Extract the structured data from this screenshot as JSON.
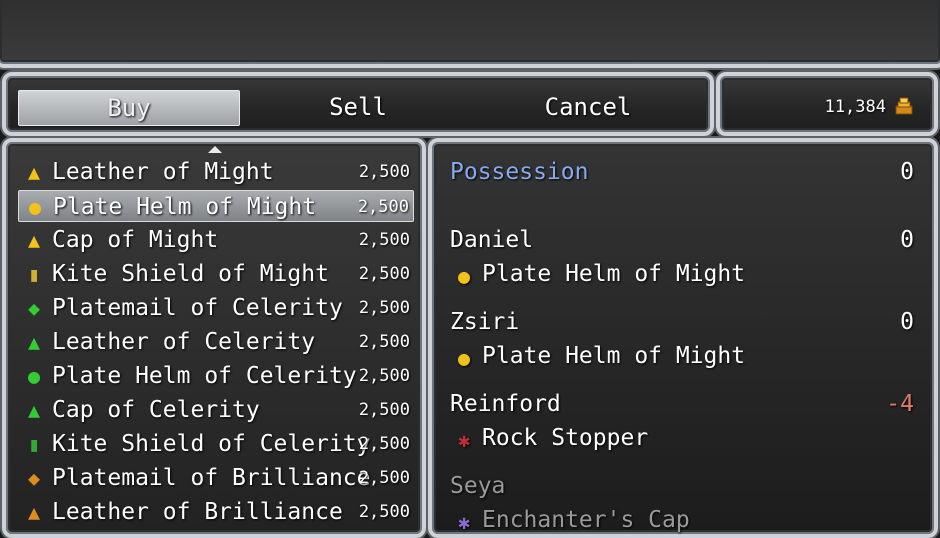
{
  "command_window": {
    "buy_label": "Buy",
    "sell_label": "Sell",
    "cancel_label": "Cancel",
    "selected": "Buy"
  },
  "gold": {
    "value": "11,384",
    "icon": "gold-coin-icon"
  },
  "item_list": [
    {
      "name": "Leather of Might",
      "price": "2,500",
      "icon": "armor-icon",
      "color": "#f2c21a"
    },
    {
      "name": "Plate Helm of Might",
      "price": "2,500",
      "icon": "helm-icon",
      "color": "#f2c21a",
      "selected": true
    },
    {
      "name": "Cap of Might",
      "price": "2,500",
      "icon": "cap-icon",
      "color": "#f2c21a"
    },
    {
      "name": "Kite Shield of Might",
      "price": "2,500",
      "icon": "shield-icon",
      "color": "#d0b030"
    },
    {
      "name": "Platemail of Celerity",
      "price": "2,500",
      "icon": "platemail-icon",
      "color": "#33cc33"
    },
    {
      "name": "Leather of Celerity",
      "price": "2,500",
      "icon": "armor-icon",
      "color": "#33cc33"
    },
    {
      "name": "Plate Helm of Celerity",
      "price": "2,500",
      "icon": "helm-icon",
      "color": "#33cc33"
    },
    {
      "name": "Cap of Celerity",
      "price": "2,500",
      "icon": "cap-icon",
      "color": "#33cc33"
    },
    {
      "name": "Kite Shield of Celerity",
      "price": "2,500",
      "icon": "shield-icon",
      "color": "#33aa33"
    },
    {
      "name": "Platemail of Brilliance",
      "price": "2,500",
      "icon": "platemail-icon",
      "color": "#e08a20"
    },
    {
      "name": "Leather of Brilliance",
      "price": "2,500",
      "icon": "armor-icon",
      "color": "#e08a20"
    }
  ],
  "status": {
    "possession_label": "Possession",
    "possession_value": "0",
    "actors": [
      {
        "name": "Daniel",
        "value": "0",
        "equip": "Plate Helm of Might",
        "equip_icon": "helm-icon",
        "equip_color": "#f2c21a",
        "value_color": "#ffffff",
        "dim": false
      },
      {
        "name": "Zsiri",
        "value": "0",
        "equip": "Plate Helm of Might",
        "equip_icon": "helm-icon",
        "equip_color": "#f2c21a",
        "value_color": "#ffffff",
        "dim": false
      },
      {
        "name": "Reinford",
        "value": "-4",
        "equip": "Rock Stopper",
        "equip_icon": "rock-helm-icon",
        "equip_color": "#c03030",
        "value_color": "#e07a6a",
        "dim": false
      },
      {
        "name": "Seya",
        "value": "",
        "equip": "Enchanter's Cap",
        "equip_icon": "enchanter-cap-icon",
        "equip_color": "#8a6ad0",
        "value_color": "#9a9a9a",
        "dim": true
      }
    ]
  }
}
